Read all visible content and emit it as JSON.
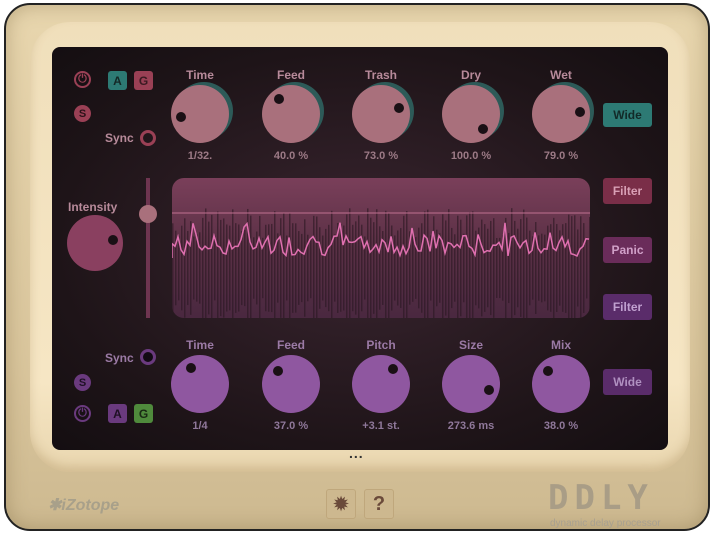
{
  "top": {
    "knobs": [
      {
        "label": "Time",
        "value": "1/32.",
        "angle": -100
      },
      {
        "label": "Feed",
        "value": "40.0 %",
        "angle": -40
      },
      {
        "label": "Trash",
        "value": "73.0 %",
        "angle": 70
      },
      {
        "label": "Dry",
        "value": "100.0 %",
        "angle": 140
      },
      {
        "label": "Wet",
        "value": "79.0 %",
        "angle": 85
      }
    ],
    "sync_label": "Sync",
    "wide_label": "Wide",
    "a_label": "A",
    "g_label": "G",
    "s_label": "S"
  },
  "bottom": {
    "knobs": [
      {
        "label": "Time",
        "value": "1/4",
        "angle": -30
      },
      {
        "label": "Feed",
        "value": "37.0 %",
        "angle": -45
      },
      {
        "label": "Pitch",
        "value": "+3.1 st.",
        "angle": 40
      },
      {
        "label": "Size",
        "value": "273.6 ms",
        "angle": 110
      },
      {
        "label": "Mix",
        "value": "38.0 %",
        "angle": -45
      }
    ],
    "sync_label": "Sync",
    "wide_label": "Wide",
    "a_label": "A",
    "g_label": "G",
    "s_label": "S"
  },
  "intensity": {
    "label": "Intensity",
    "angle": 80
  },
  "side_buttons": {
    "filter_top": "Filter",
    "panic": "Panic",
    "filter_bottom": "Filter"
  },
  "footer": {
    "brand": "iZotope",
    "product": "DDLY",
    "product_subtitle": "dynamic delay processor",
    "settings_icon": "gear-icon",
    "help_label": "?",
    "more": "..."
  },
  "colors": {
    "teal": "#2d7a74",
    "red": "#9a4055",
    "purple": "#6a3a7e",
    "green": "#4f8a3c"
  }
}
